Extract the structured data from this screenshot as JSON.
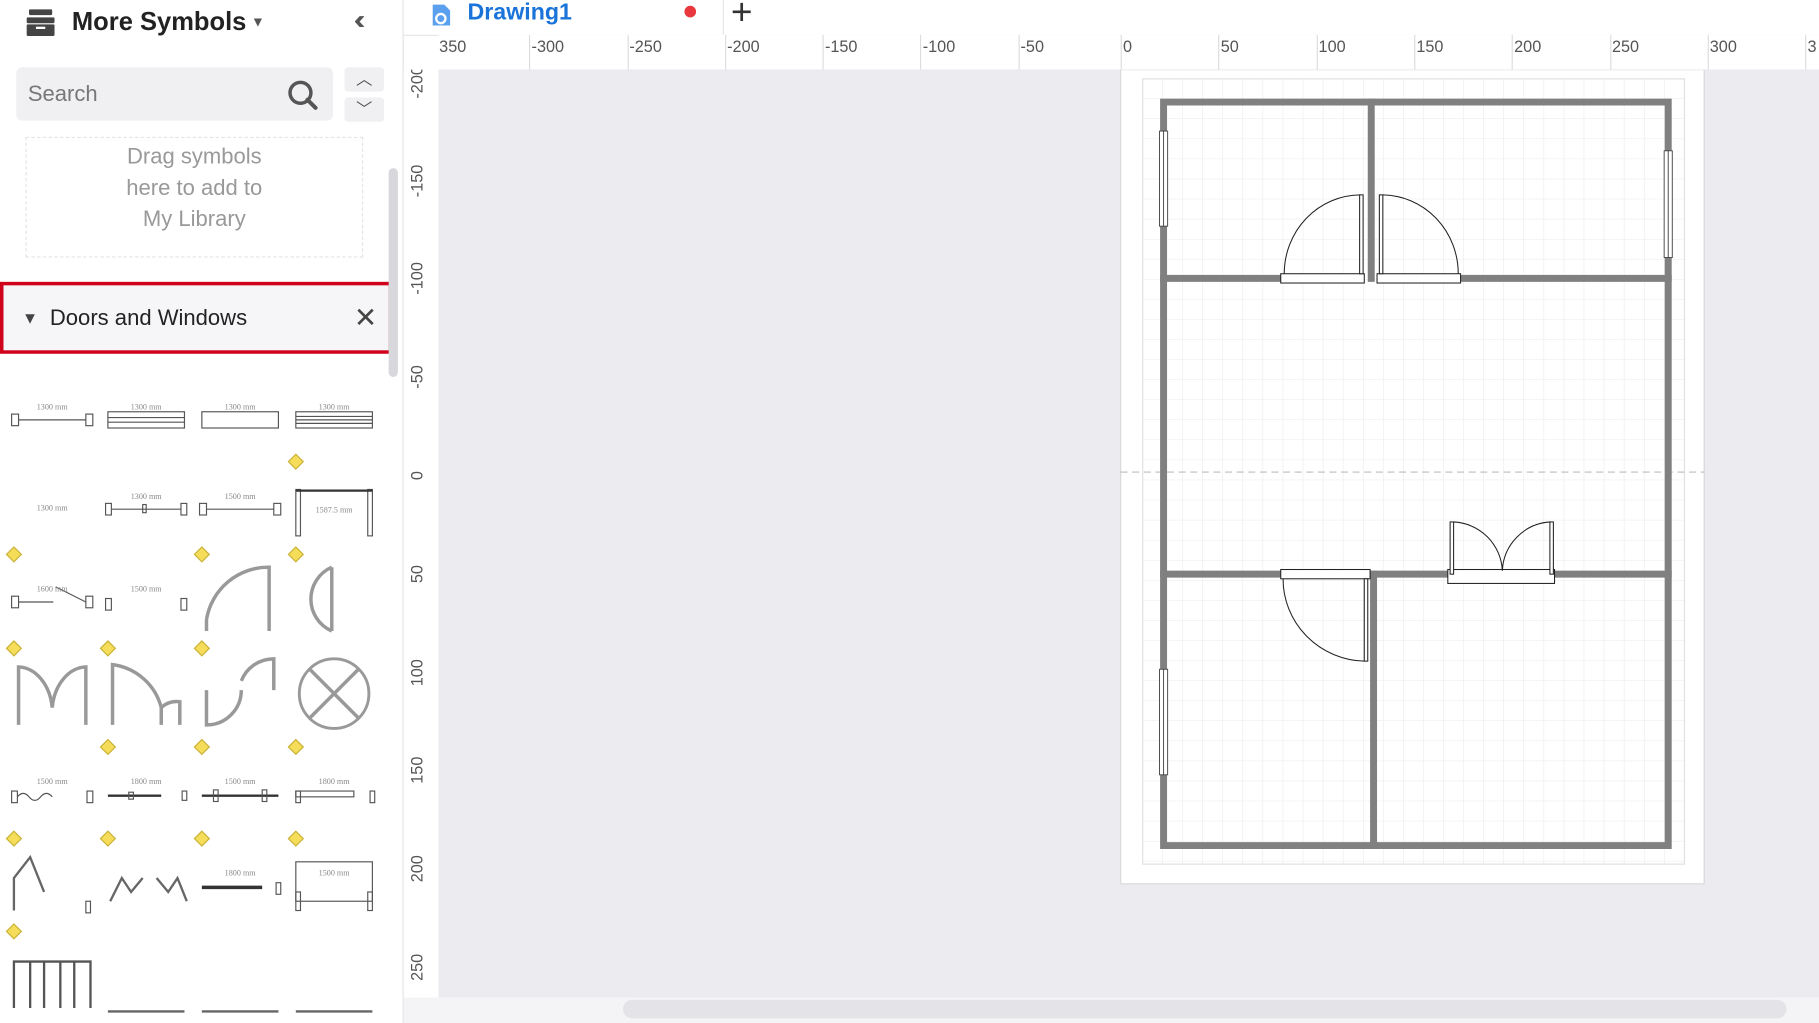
{
  "sidebar": {
    "title": "More Symbols",
    "header_icon": "library-box-icon",
    "collapse_icon": "double-chevron-left-icon",
    "search": {
      "placeholder": "Search",
      "icon": "search-icon"
    },
    "dropzone_lines": [
      "Drag symbols",
      "here to add to",
      "My Library"
    ],
    "library": {
      "title": "Doors and Windows",
      "expand_icon": "triangle-down-icon",
      "close_icon": "close-icon"
    },
    "symbols": [
      {
        "type": "window-sliding",
        "label": "1300 mm",
        "diamond": false
      },
      {
        "type": "window-double",
        "label": "1300 mm",
        "diamond": false
      },
      {
        "type": "window-fixed",
        "label": "1300 mm",
        "diamond": false
      },
      {
        "type": "window-triple",
        "label": "1300 mm",
        "diamond": false
      },
      {
        "type": "opening",
        "label": "1300 mm",
        "diamond": false
      },
      {
        "type": "window-bifold",
        "label": "1300 mm",
        "diamond": false
      },
      {
        "type": "window-sliding",
        "label": "1500 mm",
        "diamond": false
      },
      {
        "type": "bay-window",
        "label": "1587.5 mm",
        "diamond": true
      },
      {
        "type": "window-pivot",
        "label": "1600 mm",
        "diamond": true
      },
      {
        "type": "wall-opening",
        "label": "1500 mm",
        "diamond": false
      },
      {
        "type": "door-single",
        "label": "",
        "diamond": true
      },
      {
        "type": "door-double-swing",
        "label": "",
        "diamond": true
      },
      {
        "type": "door-double",
        "label": "",
        "diamond": true
      },
      {
        "type": "door-unequal",
        "label": "",
        "diamond": true
      },
      {
        "type": "door-offset",
        "label": "",
        "diamond": true
      },
      {
        "type": "door-revolving",
        "label": "",
        "diamond": false
      },
      {
        "type": "door-accordion",
        "label": "1500 mm",
        "diamond": false
      },
      {
        "type": "door-sliding",
        "label": "1800 mm",
        "diamond": true
      },
      {
        "type": "door-pocket",
        "label": "1500 mm",
        "diamond": true
      },
      {
        "type": "door-bypass",
        "label": "1800 mm",
        "diamond": true
      },
      {
        "type": "door-bifold",
        "label": "",
        "diamond": true
      },
      {
        "type": "door-bifold-double",
        "label": "",
        "diamond": true
      },
      {
        "type": "door-slide-wall",
        "label": "1800 mm",
        "diamond": true
      },
      {
        "type": "door-garage",
        "label": "1500 mm",
        "diamond": true
      },
      {
        "type": "door-folding",
        "label": "",
        "diamond": true
      },
      {
        "type": "line-partial",
        "label": "",
        "diamond": false
      },
      {
        "type": "line-partial",
        "label": "",
        "diamond": false
      },
      {
        "type": "line-partial",
        "label": "",
        "diamond": false
      }
    ]
  },
  "tab": {
    "title": "Drawing1",
    "icon": "drawing-file-icon",
    "unsaved_indicator": "#e8383d",
    "add_icon": "plus-icon"
  },
  "rulers": {
    "horizontal": [
      "-350",
      "-300",
      "-250",
      "-200",
      "-150",
      "-100",
      "-50",
      "0",
      "50",
      "100",
      "150",
      "200",
      "250",
      "300",
      "3"
    ],
    "vertical": [
      "-200",
      "-150",
      "-100",
      "-50",
      "0",
      "50",
      "100",
      "150",
      "200",
      "250"
    ]
  },
  "colors": {
    "wall": "#808080",
    "highlight": "#d0021b",
    "accent": "#1a73d9",
    "handle": "#f5dd5a"
  }
}
